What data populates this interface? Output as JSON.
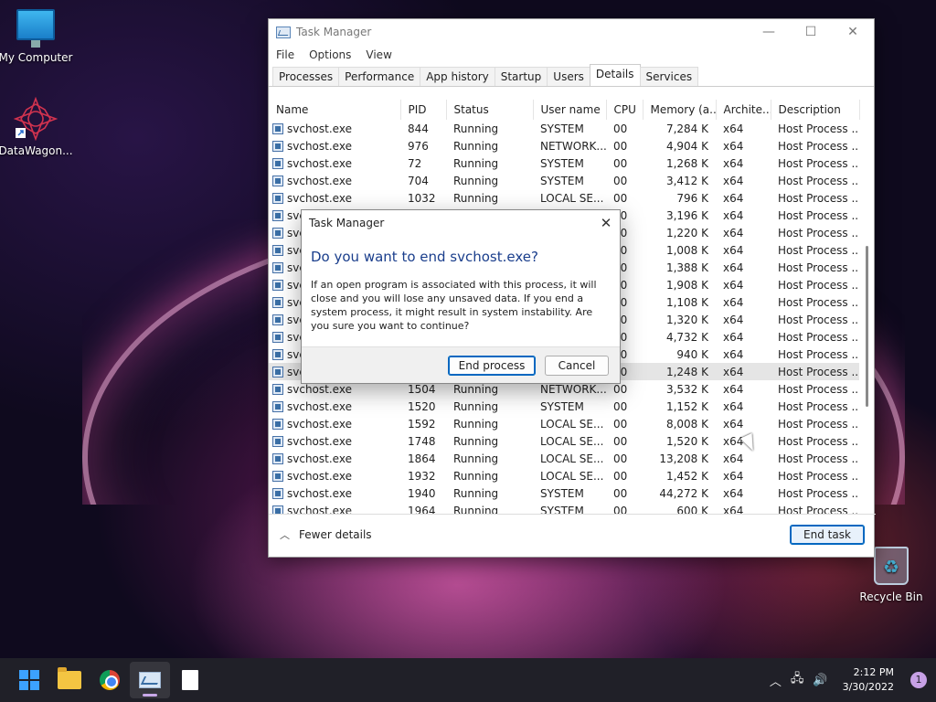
{
  "desktop": {
    "icons": [
      {
        "label": "My Computer"
      },
      {
        "label": "DataWagon..."
      },
      {
        "label": "Recycle Bin"
      }
    ]
  },
  "taskmgr": {
    "title": "Task Manager",
    "menu": [
      "File",
      "Options",
      "View"
    ],
    "tabs": [
      "Processes",
      "Performance",
      "App history",
      "Startup",
      "Users",
      "Details",
      "Services"
    ],
    "active_tab": "Details",
    "columns": [
      "Name",
      "PID",
      "Status",
      "User name",
      "CPU",
      "Memory (a...",
      "Archite...",
      "Description"
    ],
    "rows": [
      [
        "svchost.exe",
        "844",
        "Running",
        "SYSTEM",
        "00",
        "7,284 K",
        "x64",
        "Host Process ..."
      ],
      [
        "svchost.exe",
        "976",
        "Running",
        "NETWORK...",
        "00",
        "4,904 K",
        "x64",
        "Host Process ..."
      ],
      [
        "svchost.exe",
        "72",
        "Running",
        "SYSTEM",
        "00",
        "1,268 K",
        "x64",
        "Host Process ..."
      ],
      [
        "svchost.exe",
        "704",
        "Running",
        "SYSTEM",
        "00",
        "3,412 K",
        "x64",
        "Host Process ..."
      ],
      [
        "svchost.exe",
        "1032",
        "Running",
        "LOCAL SE...",
        "00",
        "796 K",
        "x64",
        "Host Process ..."
      ],
      [
        "svchost.exe",
        "",
        "",
        "",
        "00",
        "3,196 K",
        "x64",
        "Host Process ..."
      ],
      [
        "svchost.exe",
        "",
        "",
        "",
        "00",
        "1,220 K",
        "x64",
        "Host Process ..."
      ],
      [
        "svchost.exe",
        "",
        "",
        "",
        "00",
        "1,008 K",
        "x64",
        "Host Process ..."
      ],
      [
        "svchost.exe",
        "",
        "",
        "",
        "00",
        "1,388 K",
        "x64",
        "Host Process ..."
      ],
      [
        "svchost.exe",
        "",
        "",
        "",
        "00",
        "1,908 K",
        "x64",
        "Host Process ..."
      ],
      [
        "svchost.exe",
        "",
        "",
        "",
        "00",
        "1,108 K",
        "x64",
        "Host Process ..."
      ],
      [
        "svchost.exe",
        "",
        "",
        "",
        "00",
        "1,320 K",
        "x64",
        "Host Process ..."
      ],
      [
        "svchost.exe",
        "",
        "",
        "",
        "00",
        "4,732 K",
        "x64",
        "Host Process ..."
      ],
      [
        "svchost.exe",
        "",
        "",
        "",
        "00",
        "940 K",
        "x64",
        "Host Process ..."
      ],
      [
        "svchost.exe",
        "",
        "",
        "",
        "00",
        "1,248 K",
        "x64",
        "Host Process ..."
      ],
      [
        "svchost.exe",
        "1504",
        "Running",
        "NETWORK...",
        "00",
        "3,532 K",
        "x64",
        "Host Process ..."
      ],
      [
        "svchost.exe",
        "1520",
        "Running",
        "SYSTEM",
        "00",
        "1,152 K",
        "x64",
        "Host Process ..."
      ],
      [
        "svchost.exe",
        "1592",
        "Running",
        "LOCAL SE...",
        "00",
        "8,008 K",
        "x64",
        "Host Process ..."
      ],
      [
        "svchost.exe",
        "1748",
        "Running",
        "LOCAL SE...",
        "00",
        "1,520 K",
        "x64",
        "Host Process ..."
      ],
      [
        "svchost.exe",
        "1864",
        "Running",
        "LOCAL SE...",
        "00",
        "13,208 K",
        "x64",
        "Host Process ..."
      ],
      [
        "svchost.exe",
        "1932",
        "Running",
        "LOCAL SE...",
        "00",
        "1,452 K",
        "x64",
        "Host Process ..."
      ],
      [
        "svchost.exe",
        "1940",
        "Running",
        "SYSTEM",
        "00",
        "44,272 K",
        "x64",
        "Host Process ..."
      ],
      [
        "svchost.exe",
        "1964",
        "Running",
        "SYSTEM",
        "00",
        "600 K",
        "x64",
        "Host Process ..."
      ]
    ],
    "selected_row": 14,
    "fewer_details": "Fewer details",
    "end_task": "End task"
  },
  "dialog": {
    "title": "Task Manager",
    "heading": "Do you want to end svchost.exe?",
    "body": "If an open program is associated with this process, it will close and you will lose any unsaved data. If you end a system process, it might result in system instability. Are you sure you want to continue?",
    "confirm": "End process",
    "cancel": "Cancel"
  },
  "taskbar": {
    "apps": [
      "start-icon",
      "file-explorer-icon",
      "chrome-icon",
      "task-manager-icon",
      "notepad-icon"
    ],
    "time": "2:12 PM",
    "date": "3/30/2022",
    "notifications": "1"
  }
}
